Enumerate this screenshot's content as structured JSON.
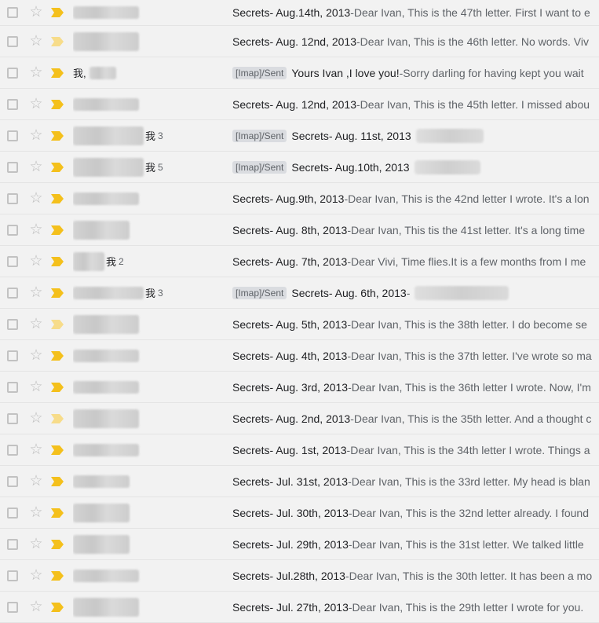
{
  "colors": {
    "importance": "#f4c01c",
    "importance_faded": "#f7dc8a",
    "star": "#bdbdbd",
    "label_bg": "#dadce0"
  },
  "icons": {
    "checkbox": "checkbox-icon",
    "star": "star-outline-icon",
    "importance": "importance-marker-icon"
  },
  "rows": [
    {
      "sender": "",
      "count": "",
      "label": "",
      "subject": "Secrets- Aug.14th, 2013",
      "separator": " - ",
      "snippet": "Dear Ivan, This is the 47th letter. First I want to e"
    },
    {
      "sender": "",
      "count": "",
      "label": "",
      "subject": "Secrets- Aug. 12nd, 2013",
      "separator": " - ",
      "snippet": "Dear Ivan, This is the 46th letter. No words. Viv"
    },
    {
      "sender": "我,",
      "count": "",
      "label": "[Imap]/Sent",
      "subject": "Yours Ivan ,I love you!",
      "separator": " - ",
      "snippet": "Sorry darling for having kept you wait"
    },
    {
      "sender": "",
      "count": "",
      "label": "",
      "subject": "Secrets- Aug. 12nd, 2013",
      "separator": " - ",
      "snippet": "Dear Ivan, This is the 45th letter. I missed abou"
    },
    {
      "sender": "我",
      "count": "3",
      "label": "[Imap]/Sent",
      "subject": "Secrets- Aug. 11st, 2013",
      "separator": "",
      "snippet": ""
    },
    {
      "sender": "我",
      "count": "5",
      "label": "[Imap]/Sent",
      "subject": "Secrets- Aug.10th, 2013",
      "separator": "",
      "snippet": ""
    },
    {
      "sender": "",
      "count": "",
      "label": "",
      "subject": "Secrets- Aug.9th, 2013",
      "separator": " - ",
      "snippet": "Dear Ivan, This is the 42nd letter I wrote. It's a lon"
    },
    {
      "sender": "",
      "count": "",
      "label": "",
      "subject": "Secrets- Aug. 8th, 2013",
      "separator": " - ",
      "snippet": "Dear Ivan, This tis the 41st letter. It's a long time"
    },
    {
      "sender": "我",
      "count": "2",
      "label": "",
      "subject": "Secrets- Aug. 7th, 2013",
      "separator": " - ",
      "snippet": "Dear Vivi, Time flies.It is a few months from I me"
    },
    {
      "sender": "我",
      "count": "3",
      "label": "[Imap]/Sent",
      "subject": "Secrets- Aug. 6th, 2013",
      "separator": " -",
      "snippet": ""
    },
    {
      "sender": "",
      "count": "",
      "label": "",
      "subject": "Secrets- Aug. 5th, 2013",
      "separator": " - ",
      "snippet": "Dear Ivan, This is the 38th letter. I do become se"
    },
    {
      "sender": "",
      "count": "",
      "label": "",
      "subject": "Secrets- Aug. 4th, 2013",
      "separator": " - ",
      "snippet": "Dear Ivan, This is the 37th letter. I've wrote so ma"
    },
    {
      "sender": "",
      "count": "",
      "label": "",
      "subject": "Secrets- Aug. 3rd, 2013",
      "separator": " - ",
      "snippet": "Dear Ivan, This is the 36th letter I wrote. Now, I'm"
    },
    {
      "sender": "",
      "count": "",
      "label": "",
      "subject": "Secrets- Aug. 2nd, 2013",
      "separator": " - ",
      "snippet": "Dear Ivan, This is the 35th letter. And a thought c"
    },
    {
      "sender": "",
      "count": "",
      "label": "",
      "subject": "Secrets- Aug. 1st, 2013",
      "separator": " - ",
      "snippet": "Dear Ivan, This is the 34th letter I wrote. Things a"
    },
    {
      "sender": "",
      "count": "",
      "label": "",
      "subject": "Secrets- Jul. 31st, 2013",
      "separator": " - ",
      "snippet": "Dear Ivan, This is the 33rd letter. My head is blan"
    },
    {
      "sender": "",
      "count": "",
      "label": "",
      "subject": "Secrets- Jul. 30th, 2013",
      "separator": " - ",
      "snippet": "Dear Ivan, This is the 32nd letter already. I found"
    },
    {
      "sender": "",
      "count": "",
      "label": "",
      "subject": "Secrets- Jul. 29th, 2013",
      "separator": " - ",
      "snippet": "Dear Ivan, This is the 31st letter. We talked little"
    },
    {
      "sender": "",
      "count": "",
      "label": "",
      "subject": "Secrets- Jul.28th, 2013",
      "separator": " - ",
      "snippet": "Dear Ivan, This is the 30th letter. It has been a mo"
    },
    {
      "sender": "",
      "count": "",
      "label": "",
      "subject": "Secrets- Jul. 27th, 2013",
      "separator": " - ",
      "snippet": "Dear Ivan, This is the 29th letter I wrote for you."
    }
  ]
}
